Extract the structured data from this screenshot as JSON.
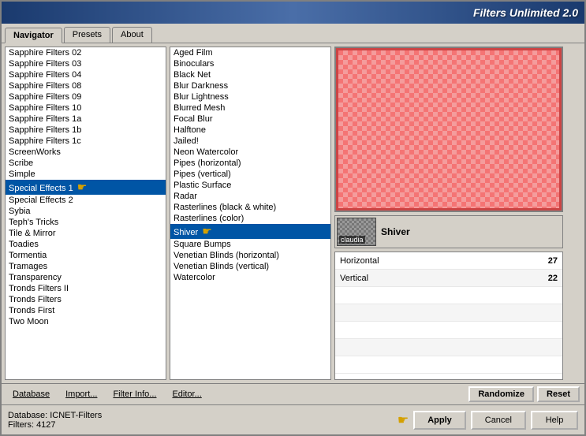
{
  "titleBar": {
    "text": "Filters Unlimited 2.0"
  },
  "tabs": [
    {
      "label": "Navigator",
      "active": true
    },
    {
      "label": "Presets",
      "active": false
    },
    {
      "label": "About",
      "active": false
    }
  ],
  "leftList": {
    "items": [
      {
        "text": "Sapphire Filters 02"
      },
      {
        "text": "Sapphire Filters 03"
      },
      {
        "text": "Sapphire Filters 04"
      },
      {
        "text": "Sapphire Filters 08"
      },
      {
        "text": "Sapphire Filters 09"
      },
      {
        "text": "Sapphire Filters 10"
      },
      {
        "text": "Sapphire Filters 1a"
      },
      {
        "text": "Sapphire Filters 1b"
      },
      {
        "text": "Sapphire Filters 1c"
      },
      {
        "text": "ScreenWorks"
      },
      {
        "text": "Scribe"
      },
      {
        "text": "Simple"
      },
      {
        "text": "Special Effects 1",
        "arrow": true,
        "selected": true
      },
      {
        "text": "Special Effects 2"
      },
      {
        "text": "Sybia"
      },
      {
        "text": "Teph's Tricks"
      },
      {
        "text": "Tile & Mirror"
      },
      {
        "text": "Toadies"
      },
      {
        "text": "Tormentia"
      },
      {
        "text": "Tramages"
      },
      {
        "text": "Transparency"
      },
      {
        "text": "Tronds Filters II"
      },
      {
        "text": "Tronds Filters"
      },
      {
        "text": "Tronds First"
      },
      {
        "text": "Two Moon"
      }
    ]
  },
  "rightList": {
    "items": [
      {
        "text": "Aged Film"
      },
      {
        "text": "Binoculars"
      },
      {
        "text": "Black Net"
      },
      {
        "text": "Blur Darkness"
      },
      {
        "text": "Blur Lightness"
      },
      {
        "text": "Blurred Mesh"
      },
      {
        "text": "Focal Blur"
      },
      {
        "text": "Halftone"
      },
      {
        "text": "Jailed!"
      },
      {
        "text": "Neon Watercolor"
      },
      {
        "text": "Pipes (horizontal)"
      },
      {
        "text": "Pipes (vertical)"
      },
      {
        "text": "Plastic Surface"
      },
      {
        "text": "Radar"
      },
      {
        "text": "Rasterlines (black & white)"
      },
      {
        "text": "Rasterlines (color)"
      },
      {
        "text": "Shiver",
        "selected": true,
        "arrow": true
      },
      {
        "text": "Square Bumps"
      },
      {
        "text": "Venetian Blinds (horizontal)"
      },
      {
        "text": "Venetian Blinds (vertical)"
      },
      {
        "text": "Watercolor"
      }
    ]
  },
  "thumbnail": {
    "label": "claudia",
    "name": "Shiver"
  },
  "params": [
    {
      "name": "Horizontal",
      "value": "27"
    },
    {
      "name": "Vertical",
      "value": "22"
    }
  ],
  "bottomToolbar": {
    "database": "Database",
    "import": "Import...",
    "filterInfo": "Filter Info...",
    "editor": "Editor...",
    "randomize": "Randomize",
    "reset": "Reset"
  },
  "statusBar": {
    "databaseLabel": "Database:",
    "databaseValue": "ICNET-Filters",
    "filtersLabel": "Filters:",
    "filtersValue": "4127"
  },
  "actionButtons": {
    "apply": "Apply",
    "cancel": "Cancel",
    "help": "Help"
  }
}
